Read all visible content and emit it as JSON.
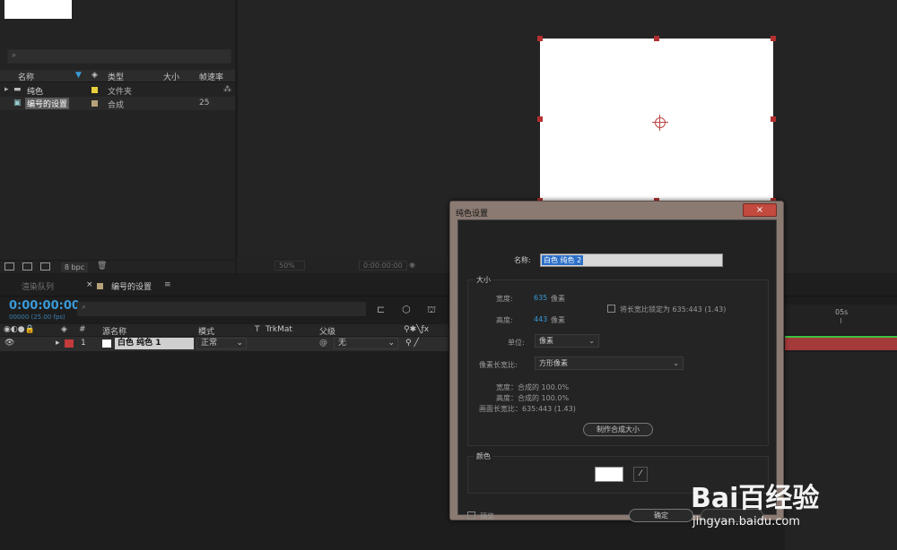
{
  "project": {
    "columns": {
      "name": "名称",
      "type": "类型",
      "size": "大小",
      "fps": "帧速率"
    },
    "items": [
      {
        "name": "纯色",
        "type": "文件夹",
        "fps": "",
        "swatch": "#e8d13a"
      },
      {
        "name": "编号的设置",
        "type": "合成",
        "fps": "25",
        "swatch": "#b7a37a"
      }
    ],
    "bpc": "8 bpc"
  },
  "viewer": {
    "zoom": "50%",
    "time": "0:00:00:00"
  },
  "timeline": {
    "tabs": {
      "render_queue": "渲染队列",
      "comp": "编号的设置"
    },
    "timecode": "0:00:00:00",
    "fps": "00000 (25.00 fps)",
    "header": {
      "num": "#",
      "source": "源名称",
      "mode": "模式",
      "t": "T",
      "trkmat": "TrkMat",
      "parent": "父级"
    },
    "layer": {
      "index": "1",
      "name": "白色 纯色 1",
      "mode": "正常",
      "parent": "无",
      "color": "#c43b3b"
    },
    "ruler_mark": "05s"
  },
  "dialog": {
    "title": "纯色设置",
    "close": "×",
    "name_label": "名称:",
    "name_value": "白色 纯色 2",
    "size_group": "大小",
    "width_label": "宽度:",
    "width_value": "635",
    "width_unit": "像素",
    "height_label": "高度:",
    "height_value": "443",
    "height_unit": "像素",
    "lock_label": "将长宽比锁定为 635:443 (1.43)",
    "unit_label": "单位:",
    "unit_value": "像素",
    "par_label": "像素长宽比:",
    "par_value": "方形像素",
    "info_width": "宽度：合成的 100.0%",
    "info_height": "高度：合成的 100.0%",
    "info_ratio": "画面长宽比：635:443 (1.43)",
    "make_comp_size": "制作合成大小",
    "color_group": "颜色",
    "color_value": "#ffffff",
    "preview_label": "预览",
    "ok": "确定"
  },
  "watermark": {
    "logo": "Bai百经验",
    "url": "jingyan.baidu.com"
  }
}
